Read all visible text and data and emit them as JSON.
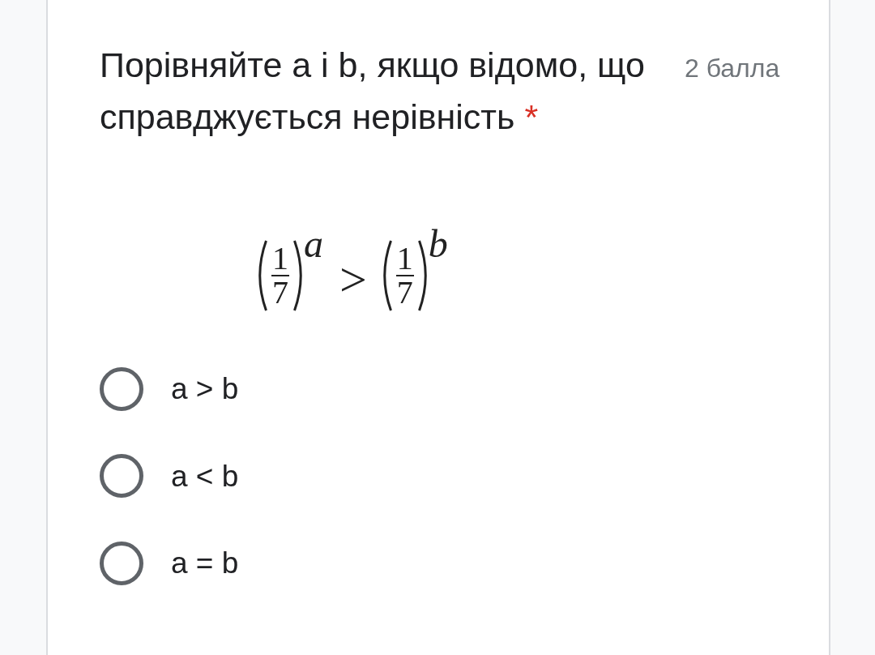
{
  "question": {
    "title": "Порівняйте a і b, якщо відомо, що справджується нерівність",
    "points": "2 балла",
    "required_mark": "*"
  },
  "formula": {
    "left": {
      "numerator": "1",
      "denominator": "7",
      "exponent": "a"
    },
    "operator": ">",
    "right": {
      "numerator": "1",
      "denominator": "7",
      "exponent": "b"
    }
  },
  "options": [
    {
      "label": "a > b",
      "selected": false
    },
    {
      "label": "a < b",
      "selected": false
    },
    {
      "label": "a = b",
      "selected": false
    }
  ]
}
